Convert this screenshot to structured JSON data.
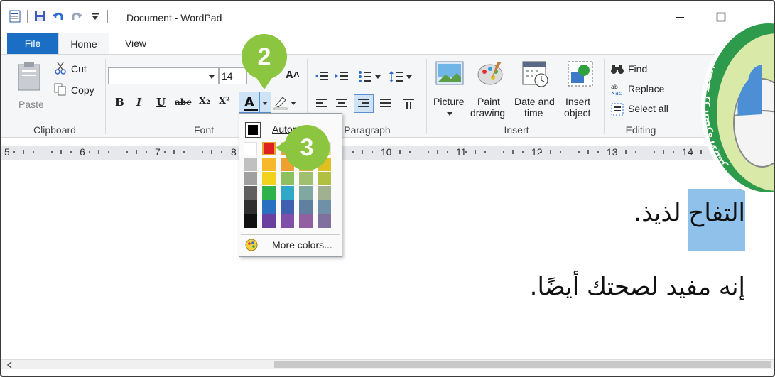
{
  "window": {
    "title": "Document - WordPad"
  },
  "tabs": [
    {
      "label": "File"
    },
    {
      "label": "Home"
    },
    {
      "label": "View"
    }
  ],
  "clipboard": {
    "paste_label": "Paste",
    "cut_label": "Cut",
    "copy_label": "Copy",
    "group_label": "Clipboard"
  },
  "font": {
    "family_value": "",
    "size_value": "14",
    "bold": "B",
    "italic": "I",
    "underline": "U",
    "strike": "abc",
    "subscript": "X₂",
    "superscript": "X²",
    "group_label": "Font"
  },
  "paragraph": {
    "group_label": "Paragraph"
  },
  "insert": {
    "picture_label": "Picture",
    "paint_label_1": "Paint",
    "paint_label_2": "drawing",
    "datetime_label_1": "Date and",
    "datetime_label_2": "time",
    "object_label_1": "Insert",
    "object_label_2": "object",
    "group_label": "Insert"
  },
  "editing": {
    "find_label": "Find",
    "replace_label": "Replace",
    "select_all_label": "Select all",
    "group_label": "Editing"
  },
  "ruler": {
    "numbers": [
      "5",
      "6",
      "7",
      "8",
      "10",
      "11",
      "12",
      "13",
      "14"
    ]
  },
  "document": {
    "line1_highlighted": "التفاح",
    "line1_rest": "لذيذ.",
    "line2": "إنه مفيد لصحتك أيضًا."
  },
  "color_menu": {
    "automatic_label": "Automatic",
    "more_colors_label": "More colors...",
    "colors": {
      "row0": [
        "#ffffff",
        "#e02020",
        "#f2a04a",
        "#f5e05a",
        "#e8e050"
      ],
      "columns": [
        [
          "#c0c0c0",
          "#a0a0a0",
          "#606060",
          "#303030",
          "#101010"
        ],
        [
          "#f7b82a",
          "#f2d21c",
          "#2fb24a",
          "#2a6fc0",
          "#6b3fa0"
        ],
        [
          "#f0a030",
          "#8fc060",
          "#30a8c8",
          "#4060b0",
          "#8050a8"
        ],
        [
          "#d8b040",
          "#a0c070",
          "#80a8a0",
          "#6080a0",
          "#9060a0"
        ],
        [
          "#e0c020",
          "#b0c040",
          "#a0b090",
          "#7090a8",
          "#8070a0"
        ]
      ]
    }
  },
  "callouts": {
    "step2": "2",
    "step3": "3"
  },
  "badge": {
    "text": "اضغط زر الفأرة الأيسر"
  }
}
